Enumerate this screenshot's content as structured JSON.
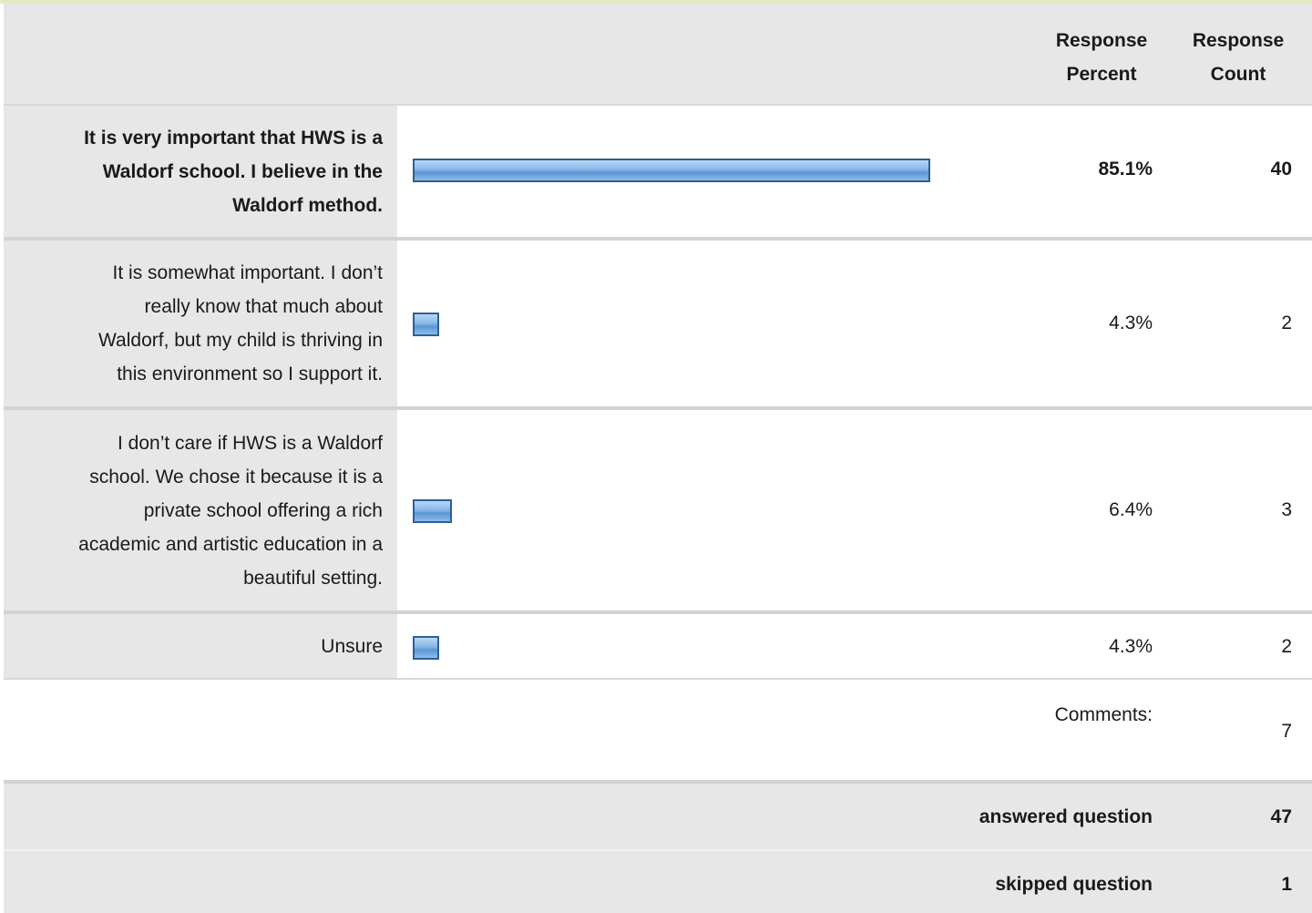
{
  "header": {
    "col_percent_line1": "Response",
    "col_percent_line2": "Percent",
    "col_count_line1": "Response",
    "col_count_line2": "Count"
  },
  "rows": [
    {
      "label_lines": [
        "It is very important that HWS is a",
        "Waldorf school. I believe in the",
        "Waldorf method."
      ],
      "percent": "85.1%",
      "percent_value": 85.1,
      "count": "40"
    },
    {
      "label_lines": [
        "It is somewhat important. I don’t",
        "really know that much about",
        "Waldorf, but my child is thriving in",
        "this environment so I support it."
      ],
      "percent": "4.3%",
      "percent_value": 4.3,
      "count": "2"
    },
    {
      "label_lines": [
        "I don’t care if HWS is a Waldorf",
        "school. We chose it because it is a",
        "private school offering a rich",
        "academic and artistic education in a",
        "beautiful setting."
      ],
      "percent": "6.4%",
      "percent_value": 6.4,
      "count": "3"
    },
    {
      "label_lines": [
        "Unsure"
      ],
      "percent": "4.3%",
      "percent_value": 4.3,
      "count": "2"
    }
  ],
  "comments": {
    "label": "Comments:",
    "count": "7"
  },
  "answered": {
    "label": "answered question",
    "count": "47"
  },
  "skipped": {
    "label": "skipped question",
    "count": "1"
  },
  "colors": {
    "bar_border": "#2f5f93",
    "bar_fill": "#7aaee4",
    "row_gray": "#e7e7e7"
  }
}
